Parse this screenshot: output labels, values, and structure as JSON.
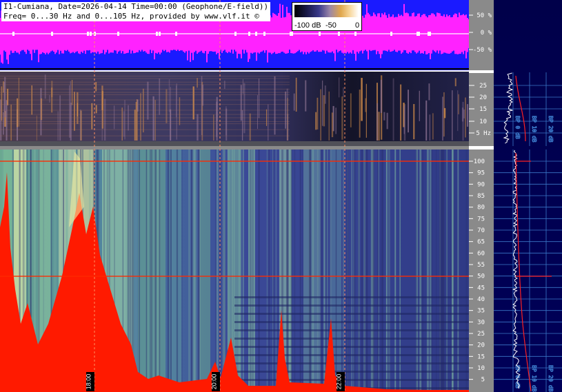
{
  "header": {
    "line1": "I1-Cumiana, Date=2026-04-14 Time=00:00 (Geophone/E-field))",
    "line2": "Freq= 0...30 Hz and 0...105 Hz, provided by www.vlf.it ©"
  },
  "colorbar": {
    "labels": [
      "-100 dB",
      "-50",
      "0"
    ]
  },
  "amplitude_axis": [
    "50 %",
    "0 %",
    "-50 %"
  ],
  "low_freq_axis": [
    "25",
    "20",
    "15",
    "10",
    "5 Hz"
  ],
  "high_freq_axis": [
    "100",
    "95",
    "90",
    "85",
    "80",
    "75",
    "70",
    "65",
    "60",
    "55",
    "50",
    "45",
    "40",
    "35",
    "30",
    "25",
    "20",
    "15",
    "10",
    "5"
  ],
  "time_markers": [
    "18:00",
    "20:00",
    "22:00"
  ],
  "profile_axis_upper": [
    "BP 0 dB",
    "BP 10 dB",
    "BP 20 dB"
  ],
  "profile_axis_lower": [
    "BP 0 dB",
    "BP 10 dB",
    "BP 20 dB"
  ],
  "colors": {
    "amp_bg": "#1a1aff",
    "amp_signal": "#ff22ff",
    "axis_panel": "#8a8a8a",
    "profile_bg": "#000050",
    "spectro_low_bg": "#2c2c5a",
    "spectro_high_bg": "#343c88",
    "hot": "#ff1a00",
    "warm": "#f4eea0",
    "green": "#5fa88a"
  }
}
